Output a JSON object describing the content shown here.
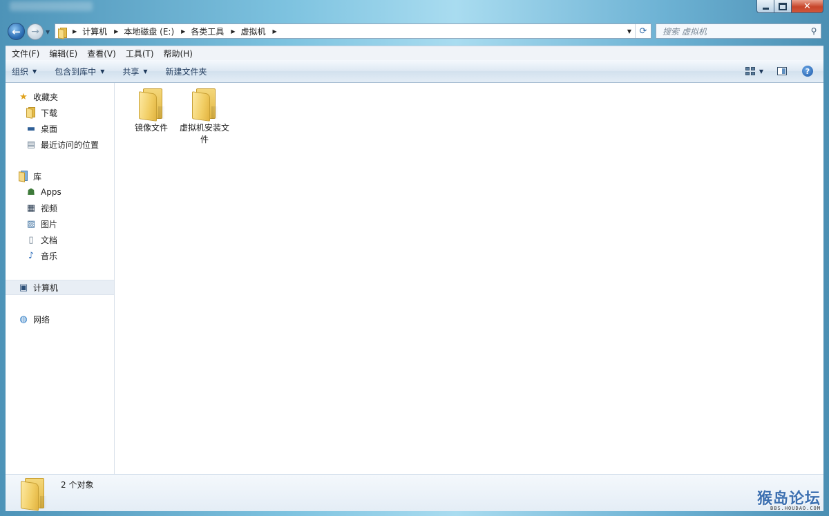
{
  "window": {
    "caption": {
      "minimize": "",
      "maximize": "",
      "close": "✕"
    }
  },
  "navigation": {
    "back_glyph": "←",
    "forward_glyph": "→",
    "history_glyph": "▼",
    "breadcrumbs": [
      "计算机",
      "本地磁盘 (E:)",
      "各类工具",
      "虚拟机"
    ],
    "crumb_sep": "▶",
    "address_dropdown": "▼",
    "refresh_glyph": "⟳",
    "search_placeholder": "搜索 虚拟机",
    "search_glyph": "⚲"
  },
  "menubar": {
    "items": [
      "文件(F)",
      "编辑(E)",
      "查看(V)",
      "工具(T)",
      "帮助(H)"
    ]
  },
  "commandbar": {
    "organize": "组织",
    "include_in_library": "包含到库中",
    "share": "共享",
    "new_folder": "新建文件夹",
    "dropdown_glyph": "▼",
    "help_glyph": "?"
  },
  "sidebar": {
    "favorites": {
      "label": "收藏夹",
      "items": [
        "下载",
        "桌面",
        "最近访问的位置"
      ]
    },
    "libraries": {
      "label": "库",
      "items": [
        "Apps",
        "视频",
        "图片",
        "文档",
        "音乐"
      ]
    },
    "computer": {
      "label": "计算机",
      "selected": true
    },
    "network": {
      "label": "网络"
    },
    "icons": {
      "star": "★",
      "desktop": "▬",
      "recent": "▤",
      "apps": "☗",
      "video": "▦",
      "picture": "▨",
      "document": "▯",
      "music": "♪",
      "computer": "▣",
      "network": "◍"
    }
  },
  "files": [
    {
      "name": "镜像文件",
      "type": "folder"
    },
    {
      "name": "虚拟机安装文件",
      "type": "folder"
    }
  ],
  "status": {
    "count_text": "2 个对象"
  },
  "watermark": {
    "title": "猴岛论坛",
    "url": "BBS.HOUDAO.COM"
  }
}
